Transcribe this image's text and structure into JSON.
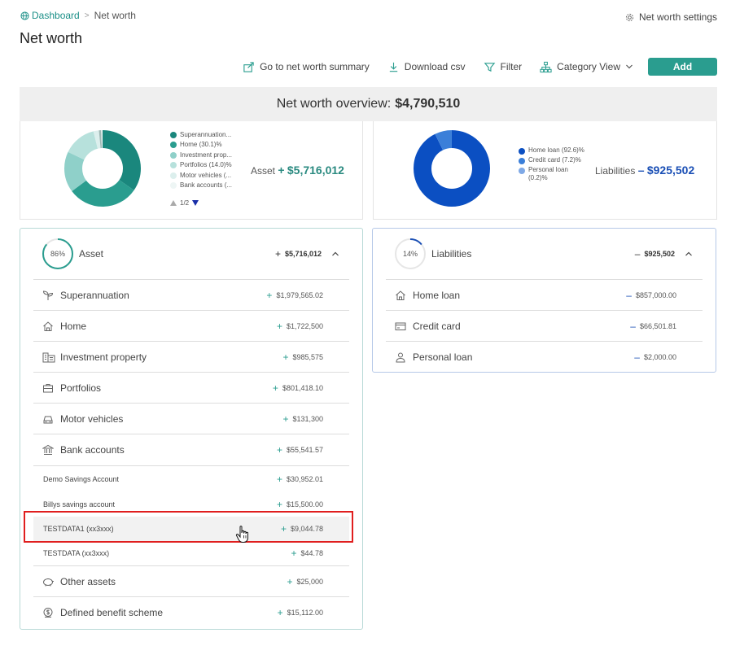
{
  "breadcrumb": {
    "home": "Dashboard",
    "separator": ">",
    "current": "Net worth"
  },
  "settings_label": "Net worth settings",
  "page_title": "Net worth",
  "toolbar": {
    "summary": "Go to net worth summary",
    "download": "Download csv",
    "filter": "Filter",
    "view": "Category View",
    "add": "Add"
  },
  "overview": {
    "label": "Net worth overview:",
    "value": "$4,790,510"
  },
  "asset_chart": {
    "legend": [
      {
        "label": "Superannuation...",
        "color": "#1a877d"
      },
      {
        "label": "Home (30.1)%",
        "color": "#2a9d8f"
      },
      {
        "label": "Investment prop...",
        "color": "#8fd0c9"
      },
      {
        "label": "Portfolios (14.0)%",
        "color": "#b7e1dc"
      },
      {
        "label": "Motor vehicles (...",
        "color": "#dcefed"
      },
      {
        "label": "Bank accounts (...",
        "color": "#eef6f5"
      }
    ],
    "pager": "1/2",
    "total_label": "Asset",
    "total_sign": "+",
    "total_value": "$5,716,012"
  },
  "liab_chart": {
    "legend": [
      {
        "label": "Home loan (92.6)%",
        "color": "#0b4fc2"
      },
      {
        "label": "Credit card (7.2)%",
        "color": "#3b7fd9"
      },
      {
        "label": "Personal loan (0.2)%",
        "color": "#7fa9e6"
      }
    ],
    "total_label": "Liabilities",
    "total_sign": "–",
    "total_value": "$925,502"
  },
  "assets": {
    "percent": "86%",
    "percent_value": 86,
    "title": "Asset",
    "sign": "+",
    "value": "$5,716,012",
    "rows": [
      {
        "label": "Superannuation",
        "value": "$1,979,565.02",
        "icon": "sprout-icon"
      },
      {
        "label": "Home",
        "value": "$1,722,500",
        "icon": "home-icon"
      },
      {
        "label": "Investment property",
        "value": "$985,575",
        "icon": "building-icon"
      },
      {
        "label": "Portfolios",
        "value": "$801,418.10",
        "icon": "briefcase-icon"
      },
      {
        "label": "Motor vehicles",
        "value": "$131,300",
        "icon": "car-icon"
      },
      {
        "label": "Bank accounts",
        "value": "$55,541.57",
        "icon": "bank-icon"
      }
    ],
    "bank_sub": [
      {
        "label": "Demo Savings Account",
        "value": "$30,952.01"
      },
      {
        "label": "Billys savings account",
        "value": "$15,500.00"
      },
      {
        "label": "TESTDATA1 (xx3xxx)",
        "value": "$9,044.78"
      },
      {
        "label": "TESTDATA (xx3xxx)",
        "value": "$44.78"
      }
    ],
    "rows_after": [
      {
        "label": "Other assets",
        "value": "$25,000",
        "icon": "piggy-bank-icon"
      },
      {
        "label": "Defined benefit scheme",
        "value": "$15,112.00",
        "icon": "coin-icon"
      }
    ]
  },
  "liabilities": {
    "percent": "14%",
    "percent_value": 14,
    "title": "Liabilities",
    "sign": "–",
    "value": "$925,502",
    "rows": [
      {
        "label": "Home loan",
        "value": "$857,000.00",
        "icon": "home-icon"
      },
      {
        "label": "Credit card",
        "value": "$66,501.81",
        "icon": "credit-card-icon"
      },
      {
        "label": "Personal loan",
        "value": "$2,000.00",
        "icon": "person-icon"
      }
    ]
  }
}
